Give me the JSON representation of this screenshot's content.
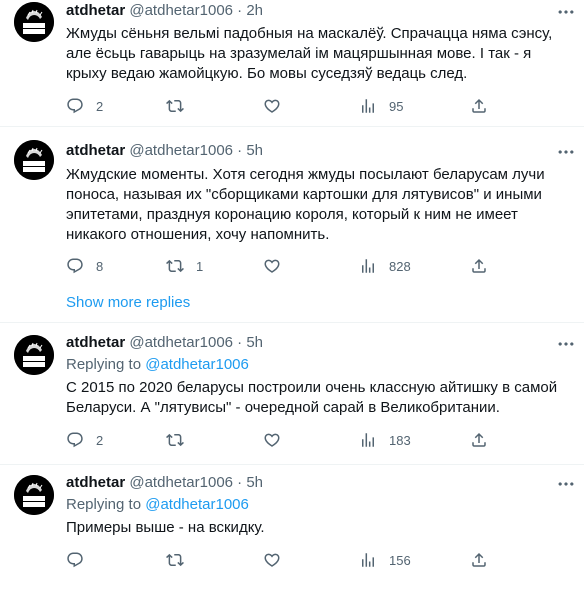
{
  "tweets": [
    {
      "name": "atdhetar",
      "handle": "@atdhetar1006",
      "dot": "·",
      "time": "2h",
      "text": "Жмуды сёньня вельмі падобныя на маскалёў. Спрачацца няма сэнсу, але ёсьць гаварыць на зразумелай ім мацяршынная мове. І так - я крыху ведаю жамойцкую. Бо мовы суседзяў ведаць след.",
      "replies": "2",
      "retweets": "",
      "likes": "",
      "views": "95"
    },
    {
      "name": "atdhetar",
      "handle": "@atdhetar1006",
      "dot": "·",
      "time": "5h",
      "text": "Жмудские моменты. Хотя сегодня жмуды посылают беларусам лучи поноса, называя их \"сборщиками картошки для лятувисов\" и иными эпитетами, празднуя коронацию короля, который к ним не имеет никакого отношения, хочу напомнить.",
      "replies": "8",
      "retweets": "1",
      "likes": "",
      "views": "828"
    },
    {
      "name": "atdhetar",
      "handle": "@atdhetar1006",
      "dot": "·",
      "time": "5h",
      "replying_label": "Replying to",
      "replying_handle": "@atdhetar1006",
      "text": "С 2015 по 2020 беларусы построили очень классную айтишку в самой Беларуси. А \"лятувисы\" - очередной сарай в Великобритании.",
      "replies": "2",
      "retweets": "",
      "likes": "",
      "views": "183"
    },
    {
      "name": "atdhetar",
      "handle": "@atdhetar1006",
      "dot": "·",
      "time": "5h",
      "replying_label": "Replying to",
      "replying_handle": "@atdhetar1006",
      "text": "Примеры выше - на вскидку.",
      "replies": "",
      "retweets": "",
      "likes": "",
      "views": "156"
    }
  ],
  "show_more_replies": "Show more replies",
  "avatar_text": [
    "ЖЫВЕ",
    "ЛЫЖЕ"
  ],
  "icons": [
    "reply-icon",
    "retweet-icon",
    "like-icon",
    "views-icon",
    "share-icon",
    "more-icon"
  ],
  "colors": {
    "text": "#0f1419",
    "secondary": "#536471",
    "link": "#1d9bf0",
    "divider": "#eff3f4"
  }
}
